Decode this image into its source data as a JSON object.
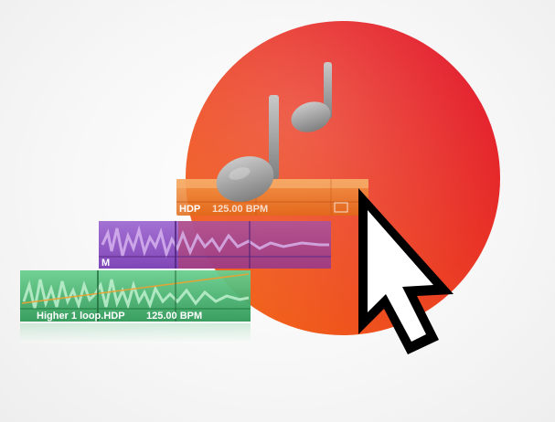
{
  "artwork": {
    "kind": "app-icon-illustration",
    "accent_colors": {
      "circle_orange": "#f26a1b",
      "circle_red": "#e0142c",
      "region_orange": "#ee7a20",
      "region_purple": "#8a4fc0",
      "region_green": "#3fae6a",
      "note_gray": "#9a9a9a"
    },
    "icons": [
      "music-notes-icon",
      "mouse-pointer-icon"
    ]
  },
  "regions": {
    "orange": {
      "name": "HDP",
      "tempo": "125.00 BPM"
    },
    "purple": {
      "name": "M"
    },
    "green": {
      "name": "Higher 1 loop.HDP",
      "tempo": "125.00 BPM"
    }
  }
}
